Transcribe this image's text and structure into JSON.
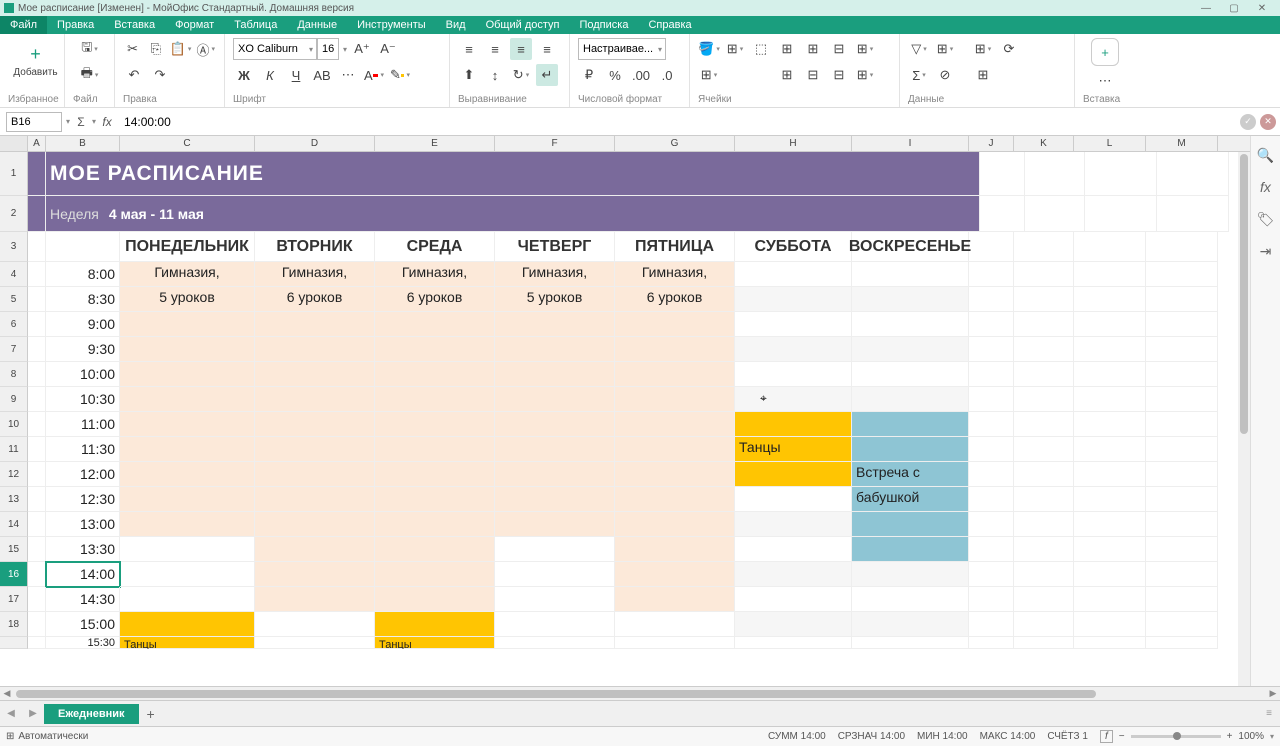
{
  "title_bar": {
    "text": "Мое расписание [Изменен] - МойОфис Стандартный. Домашняя версия"
  },
  "menu": [
    "Файл",
    "Правка",
    "Вставка",
    "Формат",
    "Таблица",
    "Данные",
    "Инструменты",
    "Вид",
    "Общий доступ",
    "Подписка",
    "Справка"
  ],
  "ribbon": {
    "add_label": "Добавить",
    "groups": {
      "favorites": "Избранное",
      "file": "Файл",
      "edit": "Правка",
      "font": "Шрифт",
      "align": "Выравнивание",
      "number": "Числовой формат",
      "cells": "Ячейки",
      "data": "Данные",
      "insert": "Вставка"
    },
    "font_name": "XO Caliburn",
    "font_size": "16",
    "number_format": "Настраивае..."
  },
  "formula": {
    "cell_ref": "B16",
    "value": "14:00:00"
  },
  "columns": [
    "A",
    "B",
    "C",
    "D",
    "E",
    "F",
    "G",
    "H",
    "I",
    "J",
    "K",
    "L",
    "M"
  ],
  "sheet": {
    "title": "МОЕ РАСПИСАНИЕ",
    "week_label": "Неделя",
    "week_range": "4 мая - 11 мая",
    "days": [
      "ПОНЕДЕЛЬНИК",
      "ВТОРНИК",
      "СРЕДА",
      "ЧЕТВЕРГ",
      "ПЯТНИЦА",
      "СУББОТА",
      "ВОСКРЕСЕНЬЕ"
    ],
    "times": [
      "8:00",
      "8:30",
      "9:00",
      "9:30",
      "10:00",
      "10:30",
      "11:00",
      "11:30",
      "12:00",
      "12:30",
      "13:00",
      "13:30",
      "14:00",
      "14:30",
      "15:00",
      "15:30"
    ],
    "gym1": "Гимназия,",
    "gym_5": "5 уроков",
    "gym_6": "6 уроков",
    "dance": "Танцы",
    "grandma1": "Встреча с",
    "grandma2": "бабушкой"
  },
  "tabs": {
    "sheet1": "Ежедневник"
  },
  "status": {
    "auto": "Автоматически",
    "sum_l": "СУММ",
    "sum_v": "14:00",
    "avg_l": "СРЗНАЧ",
    "avg_v": "14:00",
    "min_l": "МИН",
    "min_v": "14:00",
    "max_l": "МАКС",
    "max_v": "14:00",
    "cnt_l": "СЧЁТЗ",
    "cnt_v": "1",
    "zoom": "100%"
  }
}
